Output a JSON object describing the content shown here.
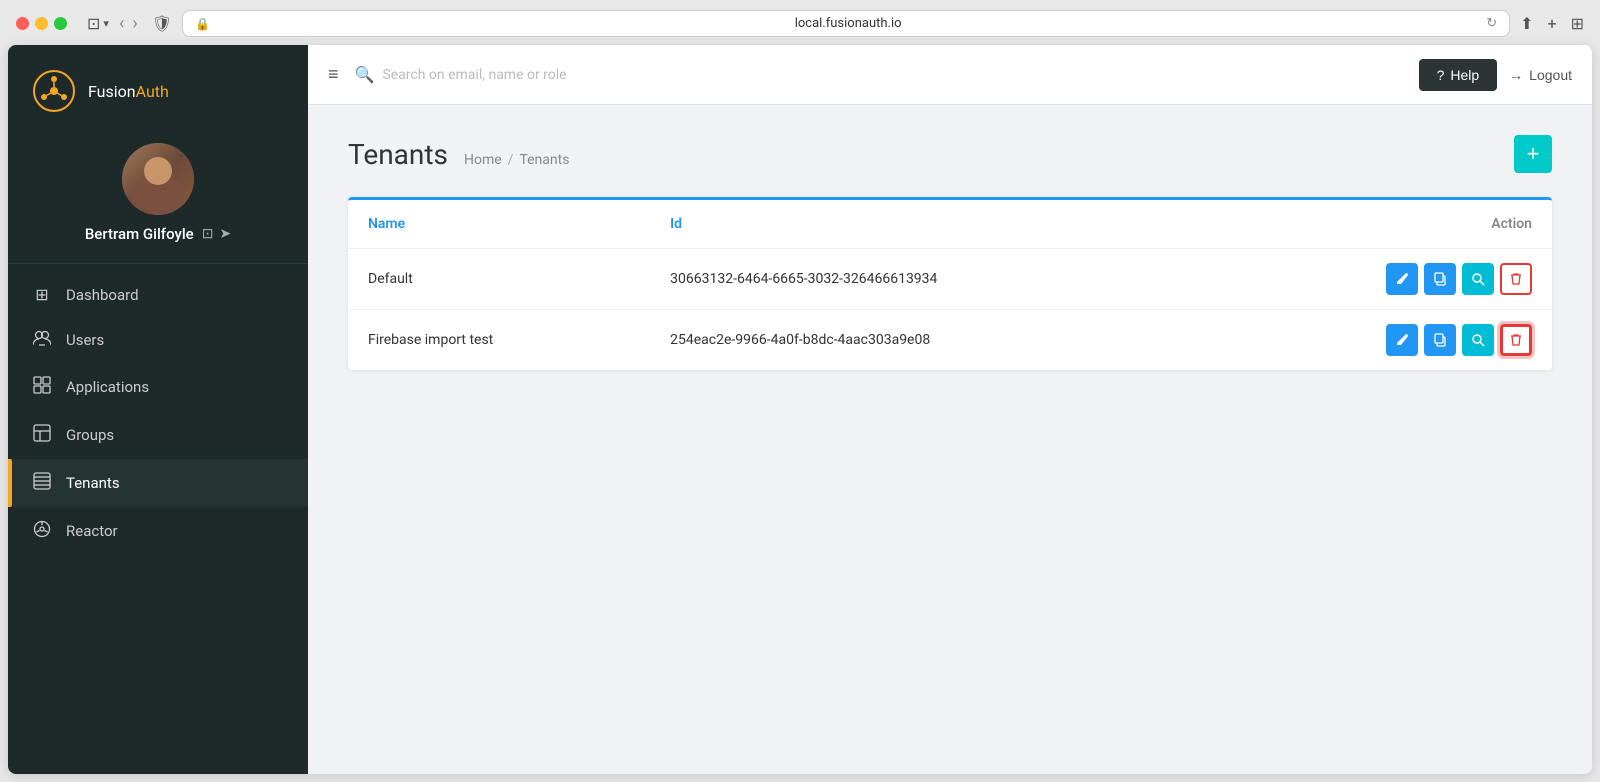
{
  "browser": {
    "url": "local.fusionauth.io"
  },
  "sidebar": {
    "logo": {
      "fusion": "Fusion",
      "auth": "Auth"
    },
    "user": {
      "name": "Bertram Gilfoyle"
    },
    "nav_items": [
      {
        "id": "dashboard",
        "label": "Dashboard",
        "icon": "⊞",
        "active": false
      },
      {
        "id": "users",
        "label": "Users",
        "icon": "👥",
        "active": false
      },
      {
        "id": "applications",
        "label": "Applications",
        "icon": "📦",
        "active": false
      },
      {
        "id": "groups",
        "label": "Groups",
        "icon": "⊡",
        "active": false
      },
      {
        "id": "tenants",
        "label": "Tenants",
        "icon": "⊟",
        "active": true
      },
      {
        "id": "reactor",
        "label": "Reactor",
        "icon": "☢",
        "active": false
      }
    ]
  },
  "topbar": {
    "search_placeholder": "Search on email, name or role",
    "help_label": "Help",
    "logout_label": "Logout"
  },
  "page": {
    "title": "Tenants",
    "breadcrumb_home": "Home",
    "breadcrumb_current": "Tenants",
    "add_button_label": "+"
  },
  "table": {
    "columns": {
      "name": "Name",
      "id": "Id",
      "action": "Action"
    },
    "rows": [
      {
        "name": "Default",
        "id": "30663132-6464-6665-3032-326466613934",
        "highlighted_delete": false
      },
      {
        "name": "Firebase import test",
        "id": "254eac2e-9966-4a0f-b8dc-4aac303a9e08",
        "highlighted_delete": true
      }
    ]
  }
}
